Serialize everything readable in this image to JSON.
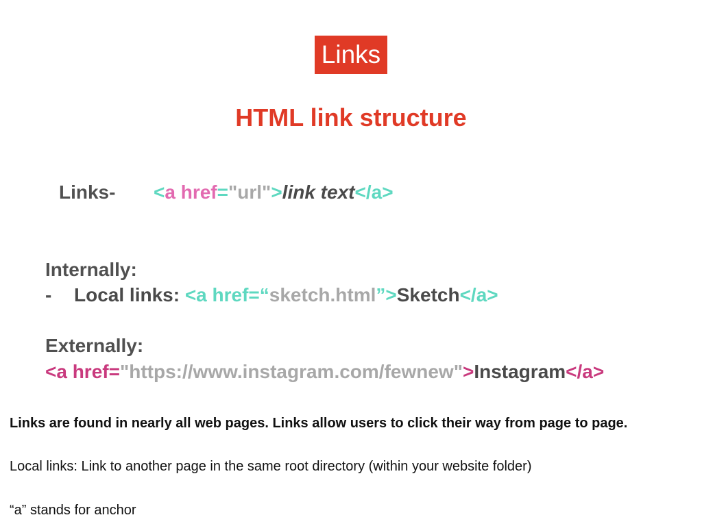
{
  "slide": {
    "title": "Links",
    "subtitle": "HTML link structure",
    "structure_line": {
      "label": "Links-",
      "lt": "<",
      "a_href": "a href",
      "eq": "=",
      "url": "\"url\"",
      "gt": ">",
      "link_text": "link text",
      "close": "</a>"
    },
    "internal": {
      "heading": "Internally:",
      "dash": "-",
      "label": "Local links: ",
      "open": "<a href=“",
      "href": "sketch.html",
      "close_quote": "”>",
      "link_text": "Sketch",
      "close": "</a>"
    },
    "external": {
      "heading": "Externally:",
      "open": "<a href=",
      "href": "\"https://www.instagram.com/fewnew\"",
      "gt": ">",
      "link_text": "Instagram",
      "close": "</a>"
    },
    "notes": [
      "Links are found in nearly all web pages. Links allow users to click their way from page to page.",
      "Local links: Link to another page in the same root directory (within your website folder)",
      "“a” stands for anchor"
    ]
  },
  "colors": {
    "accent_red": "#E03A26",
    "tag_teal": "#5ED8C0",
    "attr_pink": "#E26AB0",
    "tag_magenta": "#C93A7E",
    "value_gray": "#A8A8A8",
    "text_dark": "#4A4A4A"
  }
}
